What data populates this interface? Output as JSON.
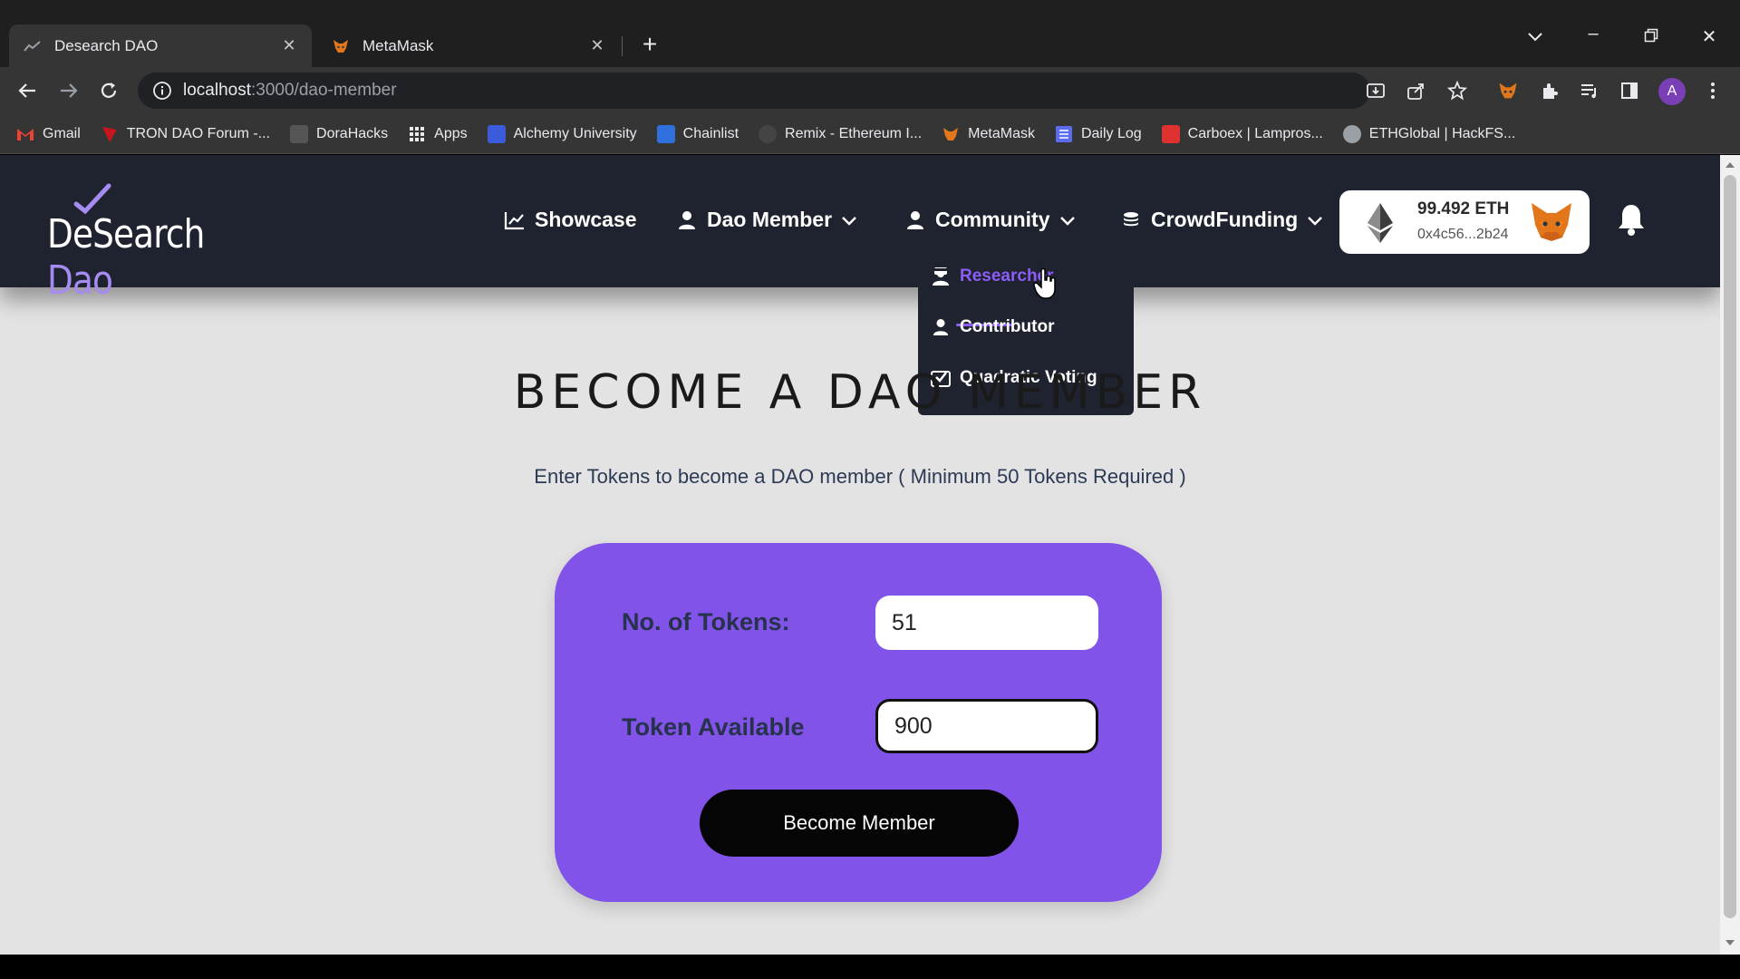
{
  "browser": {
    "tabs": [
      {
        "title": "Desearch DAO",
        "active": true
      },
      {
        "title": "MetaMask",
        "active": false
      }
    ],
    "url_host": "localhost",
    "url_path": ":3000/dao-member",
    "profile_initial": "A",
    "bookmarks": [
      {
        "label": "Gmail",
        "icon": "gmail-icon",
        "color": "#ea4335"
      },
      {
        "label": "TRON DAO Forum -...",
        "icon": "tron-icon",
        "color": "#c4161c"
      },
      {
        "label": "DoraHacks",
        "icon": "dorahacks-icon",
        "color": "#555555"
      },
      {
        "label": "Apps",
        "icon": "apps-grid-icon",
        "color": "#e8eaed"
      },
      {
        "label": "Alchemy University",
        "icon": "alchemy-icon",
        "color": "#3b5bdb"
      },
      {
        "label": "Chainlist",
        "icon": "chainlist-icon",
        "color": "#2f6fde"
      },
      {
        "label": "Remix - Ethereum I...",
        "icon": "remix-icon",
        "color": "#444444"
      },
      {
        "label": "MetaMask",
        "icon": "metamask-icon",
        "color": "#e2761b"
      },
      {
        "label": "Daily Log",
        "icon": "list-icon",
        "color": "#5b6cf0"
      },
      {
        "label": "Carboex | Lampros...",
        "icon": "carboex-icon",
        "color": "#e03131"
      },
      {
        "label": "ETHGlobal | HackFS...",
        "icon": "ethglobal-icon",
        "color": "#9aa0a6"
      }
    ]
  },
  "navbar": {
    "logo_part1": "DeSearch ",
    "logo_part2": "Dao",
    "items": [
      {
        "label": "Showcase",
        "icon": "chart-line-icon"
      },
      {
        "label": "Dao Member",
        "icon": "user-icon"
      },
      {
        "label": "Community",
        "icon": "user-icon"
      },
      {
        "label": "CrowdFunding",
        "icon": "coins-icon"
      }
    ],
    "wallet": {
      "balance": "99.492 ETH",
      "address": "0x4c56...2b24"
    }
  },
  "community_dropdown": {
    "items": [
      {
        "label": "Researcher",
        "icon": "researcher-icon",
        "active": true
      },
      {
        "label": "Contributor",
        "icon": "user-icon",
        "active": false
      },
      {
        "label": "Quadratic Voting",
        "icon": "vote-check-icon",
        "active": false
      }
    ]
  },
  "main": {
    "title": "BECOME A DAO MEMBER",
    "subtitle": "Enter Tokens to become a DAO member ( Minimum 50 Tokens Required )",
    "form": {
      "tokens_label": "No. of Tokens:",
      "tokens_value": "51",
      "available_label": "Token Available",
      "available_value": "900",
      "submit_label": "Become Member"
    }
  },
  "colors": {
    "accent": "#8153e8",
    "active_link": "#8b5cf6",
    "navbar_bg": "#1f2330",
    "page_bg": "#e3e3e3"
  }
}
